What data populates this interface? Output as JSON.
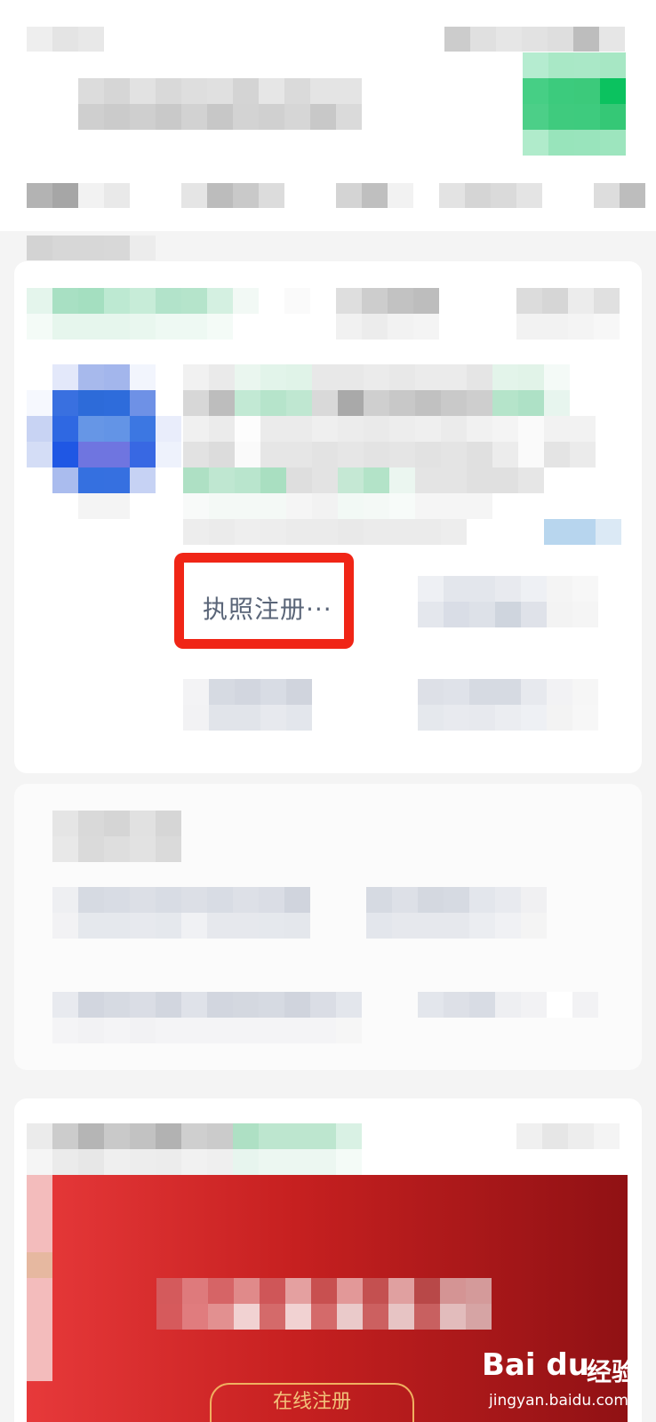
{
  "highlighted_item": {
    "label": "执照注册···"
  },
  "promo_banner": {
    "button_label": "在线注册"
  },
  "watermark": {
    "brand": "Bai du",
    "brand_cn": "经验",
    "url": "jingyan.baidu.com"
  },
  "colors": {
    "highlight": "#f02516",
    "brand_green": "#07c160",
    "banner_red": "#c62020"
  }
}
